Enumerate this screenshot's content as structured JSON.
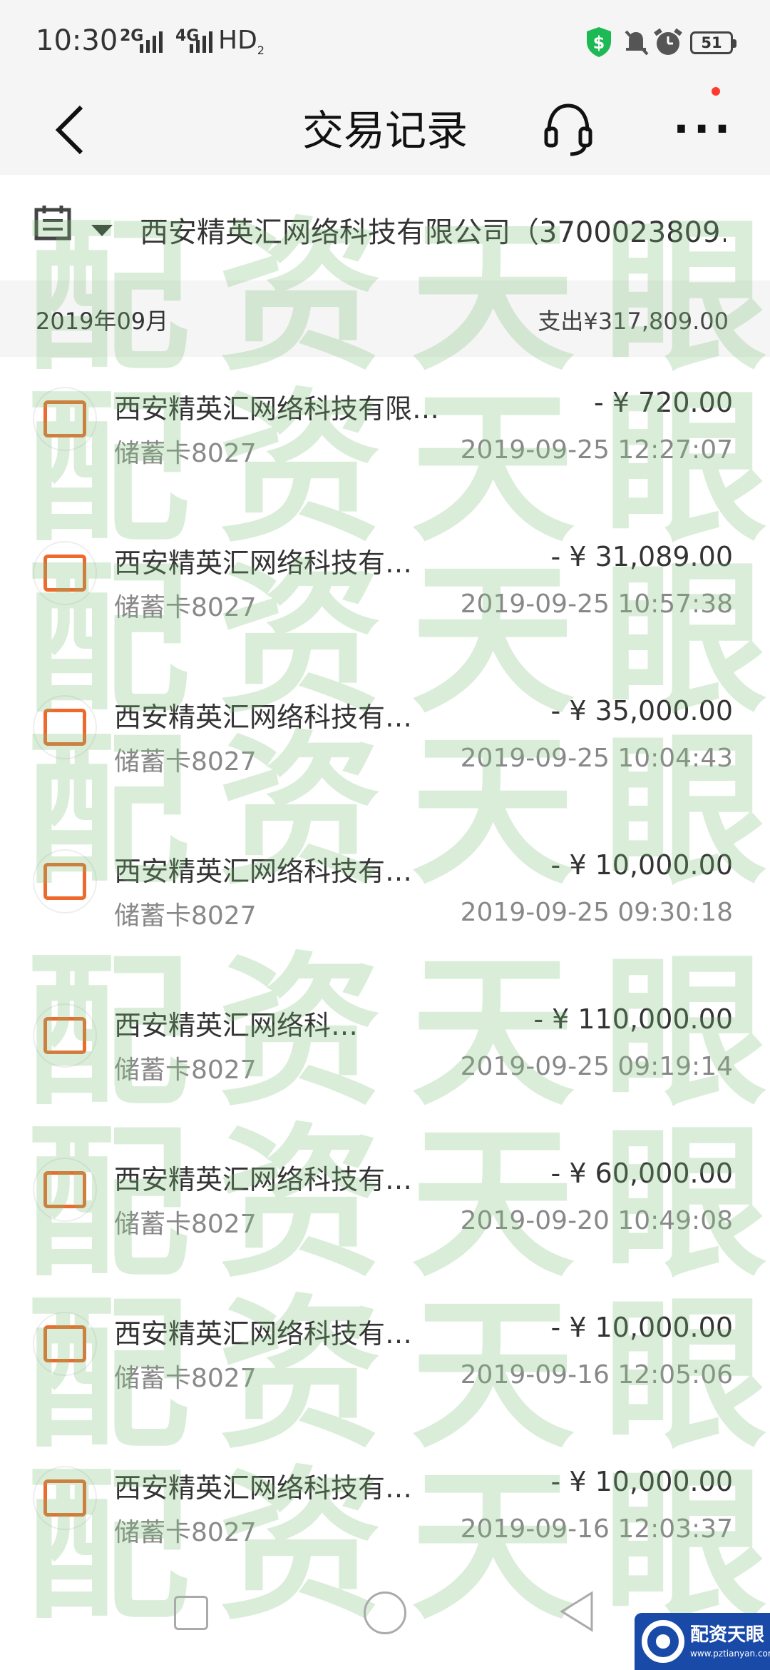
{
  "status_bar": {
    "time": "10:30",
    "net1": "2G",
    "net2": "4G",
    "hd": "HD",
    "hd_sub": "2",
    "battery": "51",
    "icons": [
      "shield-dollar-icon",
      "bell-muted-icon",
      "alarm-icon",
      "battery-icon"
    ]
  },
  "header": {
    "title": "交易记录",
    "icons": [
      "back-arrow-icon",
      "headset-icon",
      "more-icon"
    ]
  },
  "account": {
    "name": "西安精英汇网络科技有限公司（3700023809…"
  },
  "summary": {
    "month": "2019年09月",
    "total": "支出¥317,809.00"
  },
  "transactions": [
    {
      "name": "西安精英汇网络科技有限…",
      "card": "储蓄卡8027",
      "amount": "- ¥ 720.00",
      "time": "2019-09-25 12:27:07"
    },
    {
      "name": "西安精英汇网络科技有…",
      "card": "储蓄卡8027",
      "amount": "- ¥ 31,089.00",
      "time": "2019-09-25 10:57:38"
    },
    {
      "name": "西安精英汇网络科技有…",
      "card": "储蓄卡8027",
      "amount": "- ¥ 35,000.00",
      "time": "2019-09-25 10:04:43"
    },
    {
      "name": "西安精英汇网络科技有…",
      "card": "储蓄卡8027",
      "amount": "- ¥ 10,000.00",
      "time": "2019-09-25 09:30:18"
    },
    {
      "name": "西安精英汇网络科…",
      "card": "储蓄卡8027",
      "amount": "- ¥ 110,000.00",
      "time": "2019-09-25 09:19:14"
    },
    {
      "name": "西安精英汇网络科技有…",
      "card": "储蓄卡8027",
      "amount": "- ¥ 60,000.00",
      "time": "2019-09-20 10:49:08"
    },
    {
      "name": "西安精英汇网络科技有…",
      "card": "储蓄卡8027",
      "amount": "- ¥ 10,000.00",
      "time": "2019-09-16 12:05:06"
    },
    {
      "name": "西安精英汇网络科技有…",
      "card": "储蓄卡8027",
      "amount": "- ¥ 10,000.00",
      "time": "2019-09-16 12:03:37"
    }
  ],
  "watermark": {
    "text": "配资天眼"
  },
  "logo": {
    "text": "配资天眼",
    "url": "www.pztianyan.com"
  },
  "colors": {
    "accent": "#ee6a2c",
    "watermark": "#78be78",
    "background": "#f5f5f5"
  }
}
